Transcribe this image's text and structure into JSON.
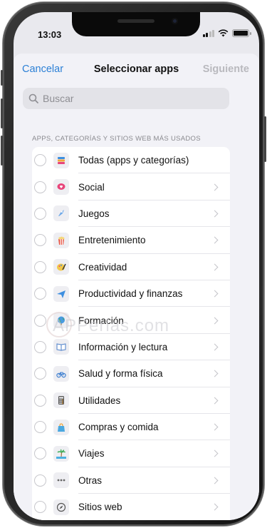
{
  "status_bar": {
    "time": "13:03",
    "icons": [
      "cellular-signal-icon",
      "wifi-icon",
      "battery-icon"
    ]
  },
  "navbar": {
    "cancel_label": "Cancelar",
    "title": "Seleccionar apps",
    "next_label": "Siguiente",
    "next_enabled": false
  },
  "search": {
    "placeholder": "Buscar",
    "value": ""
  },
  "section": {
    "header": "APPS, CATEGORÍAS Y SITIOS WEB MÁS USADOS"
  },
  "categories": [
    {
      "label": "Todas (apps y categorías)",
      "icon": "stack-layers-icon",
      "color": "#f0a43a",
      "chevron": false
    },
    {
      "label": "Social",
      "icon": "chat-heart-icon",
      "color": "#e8457a",
      "chevron": true
    },
    {
      "label": "Juegos",
      "icon": "rocket-icon",
      "color": "#6ea8e8",
      "chevron": true
    },
    {
      "label": "Entretenimiento",
      "icon": "popcorn-icon",
      "color": "#e85a4a",
      "chevron": true
    },
    {
      "label": "Creatividad",
      "icon": "palette-icon",
      "color": "#f2c84b",
      "chevron": true
    },
    {
      "label": "Productividad y finanzas",
      "icon": "paper-plane-icon",
      "color": "#3d8fe0",
      "chevron": true
    },
    {
      "label": "Formación",
      "icon": "globe-icon",
      "color": "#3aa655",
      "chevron": true
    },
    {
      "label": "Información y lectura",
      "icon": "open-book-icon",
      "color": "#4a7ec8",
      "chevron": true
    },
    {
      "label": "Salud y forma física",
      "icon": "bicycle-icon",
      "color": "#3d7fd0",
      "chevron": true
    },
    {
      "label": "Utilidades",
      "icon": "calculator-icon",
      "color": "#555555",
      "chevron": true
    },
    {
      "label": "Compras y comida",
      "icon": "shopping-bag-icon",
      "color": "#4aa8e0",
      "chevron": true
    },
    {
      "label": "Viajes",
      "icon": "palm-tree-icon",
      "color": "#3fae5a",
      "chevron": true
    },
    {
      "label": "Otras",
      "icon": "ellipsis-icon",
      "color": "#666666",
      "chevron": true
    },
    {
      "label": "Sitios web",
      "icon": "compass-icon",
      "color": "#555555",
      "chevron": true
    }
  ],
  "watermark": "APPerlas.com",
  "colors": {
    "accent": "#2c80d6",
    "disabled": "#b9b9be",
    "background": "#f2f2f7"
  }
}
